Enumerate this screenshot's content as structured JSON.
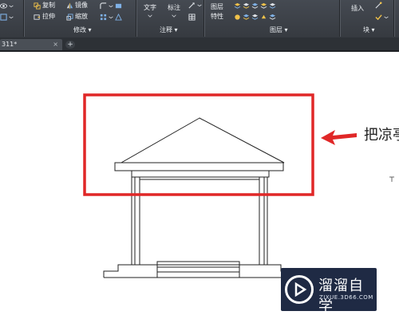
{
  "ribbon": {
    "modify": {
      "copy_label": "复制",
      "mirror_label": "镜像",
      "stretch_label": "拉伸",
      "scale_label": "缩放",
      "section_label": "修改 ▾"
    },
    "annotation": {
      "text_label": "文字",
      "dim_label": "标注",
      "section_label": "注释 ▾"
    },
    "layers": {
      "props_label_1": "图层",
      "props_label_2": "特性",
      "section_label": "图层 ▾"
    },
    "block": {
      "insert_label": "插入",
      "section_label": "块 ▾"
    }
  },
  "tabs": {
    "doc_tab_label": "311*",
    "close_glyph": "×",
    "new_tab_glyph": "+"
  },
  "canvas": {
    "callout_text": "把凉亭",
    "highlight_color": "#e02727",
    "arrow_color": "#e02727",
    "line_color": "#222222"
  },
  "watermark": {
    "title": "溜溜自学",
    "url": "ZIXUE.3D66.COM"
  }
}
